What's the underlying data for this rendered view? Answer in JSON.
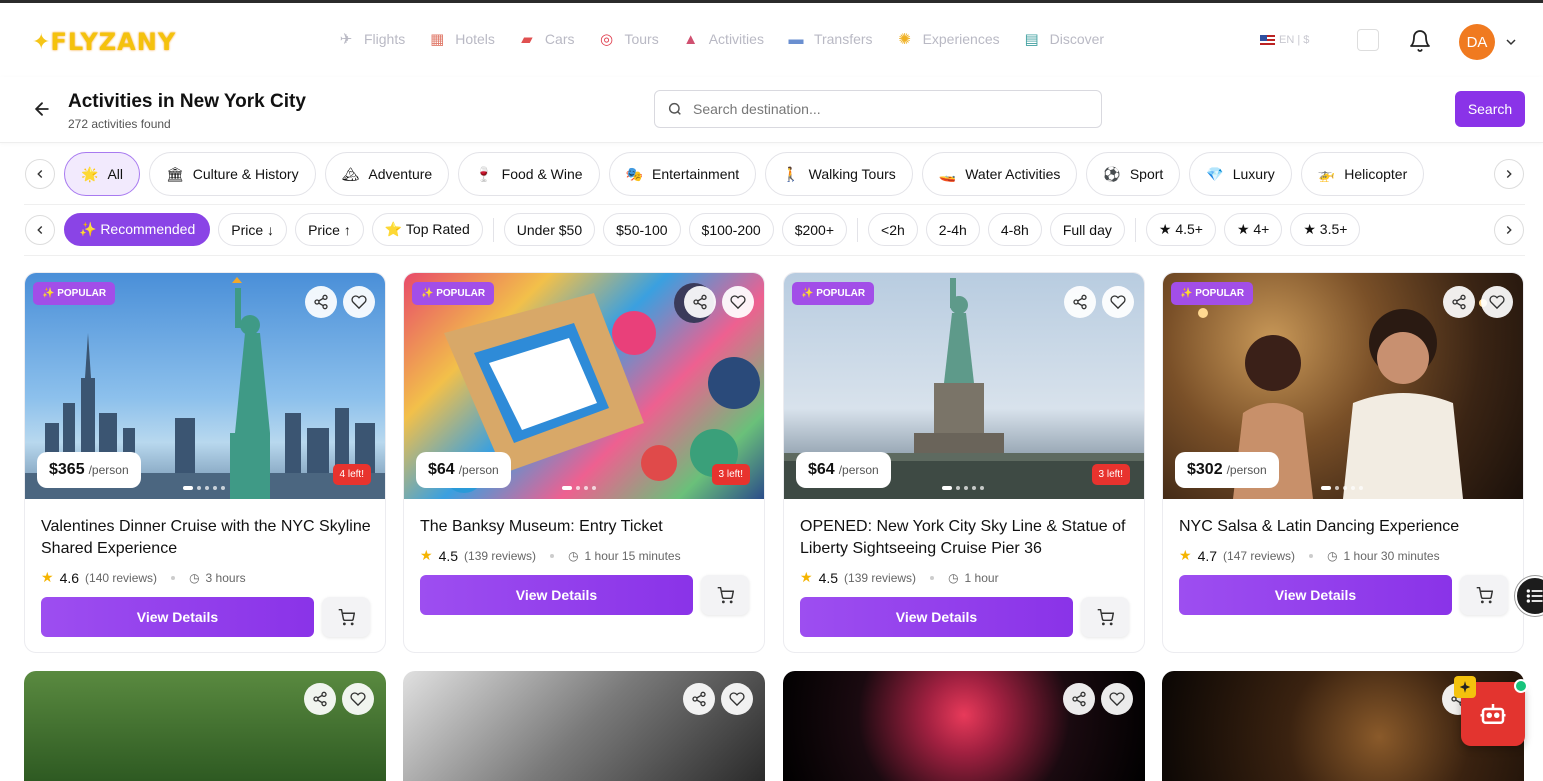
{
  "app": {
    "logo_text": "FLYZANY"
  },
  "nav": {
    "links": [
      {
        "label": "Flights",
        "icon": "airplane-icon"
      },
      {
        "label": "Hotels",
        "icon": "hotel-icon"
      },
      {
        "label": "Cars",
        "icon": "car-icon"
      },
      {
        "label": "Tours",
        "icon": "target-icon"
      },
      {
        "label": "Activities",
        "icon": "tent-icon"
      },
      {
        "label": "Transfers",
        "icon": "bus-icon"
      },
      {
        "label": "Experiences",
        "icon": "sparkle-icon"
      },
      {
        "label": "Discover",
        "icon": "map-icon"
      }
    ],
    "language": "EN | $",
    "avatar": "DA"
  },
  "header": {
    "title": "Activities in New York City",
    "count": "272 activities found",
    "search_placeholder": "Search destination...",
    "search_button": "Search"
  },
  "categories": [
    {
      "label": "All",
      "emoji": "🌟",
      "active": true
    },
    {
      "label": "Culture & History",
      "emoji": "🏛"
    },
    {
      "label": "Adventure",
      "emoji": "🏔"
    },
    {
      "label": "Food & Wine",
      "emoji": "🍷"
    },
    {
      "label": "Entertainment",
      "emoji": "🎭"
    },
    {
      "label": "Walking Tours",
      "emoji": "🚶"
    },
    {
      "label": "Water Activities",
      "emoji": "🚤"
    },
    {
      "label": "Sport",
      "emoji": "⚽"
    },
    {
      "label": "Luxury",
      "emoji": "💎"
    },
    {
      "label": "Helicopter",
      "emoji": "🚁"
    }
  ],
  "filters": {
    "sort": [
      {
        "label": "✨ Recommended",
        "active": true
      },
      {
        "label": "Price ↓"
      },
      {
        "label": "Price ↑"
      },
      {
        "label": "⭐ Top Rated"
      }
    ],
    "price": [
      "Under $50",
      "$50-100",
      "$100-200",
      "$200+"
    ],
    "duration": [
      "<2h",
      "2-4h",
      "4-8h",
      "Full day"
    ],
    "rating": [
      "★ 4.5+",
      "★ 4+",
      "★ 3.5+"
    ]
  },
  "cards": [
    {
      "badge": "✨ POPULAR",
      "price": "$365",
      "unit": "/person",
      "left": "4 left!",
      "title": "Valentines Dinner Cruise with the NYC Skyline Shared Experience",
      "rating": "4.6",
      "reviews": "(140 reviews)",
      "duration": "3 hours",
      "button": "View Details"
    },
    {
      "badge": "✨ POPULAR",
      "price": "$64",
      "unit": "/person",
      "left": "3 left!",
      "title": "The Banksy Museum: Entry Ticket",
      "rating": "4.5",
      "reviews": "(139 reviews)",
      "duration": "1 hour 15 minutes",
      "button": "View Details"
    },
    {
      "badge": "✨ POPULAR",
      "price": "$64",
      "unit": "/person",
      "left": "3 left!",
      "title": "OPENED: New York City Sky Line & Statue of Liberty Sightseeing Cruise Pier 36",
      "rating": "4.5",
      "reviews": "(139 reviews)",
      "duration": "1 hour",
      "button": "View Details"
    },
    {
      "badge": "✨ POPULAR",
      "price": "$302",
      "unit": "/person",
      "left": "",
      "title": "NYC Salsa & Latin Dancing Experience",
      "rating": "4.7",
      "reviews": "(147 reviews)",
      "duration": "1 hour 30 minutes",
      "button": "View Details"
    }
  ]
}
